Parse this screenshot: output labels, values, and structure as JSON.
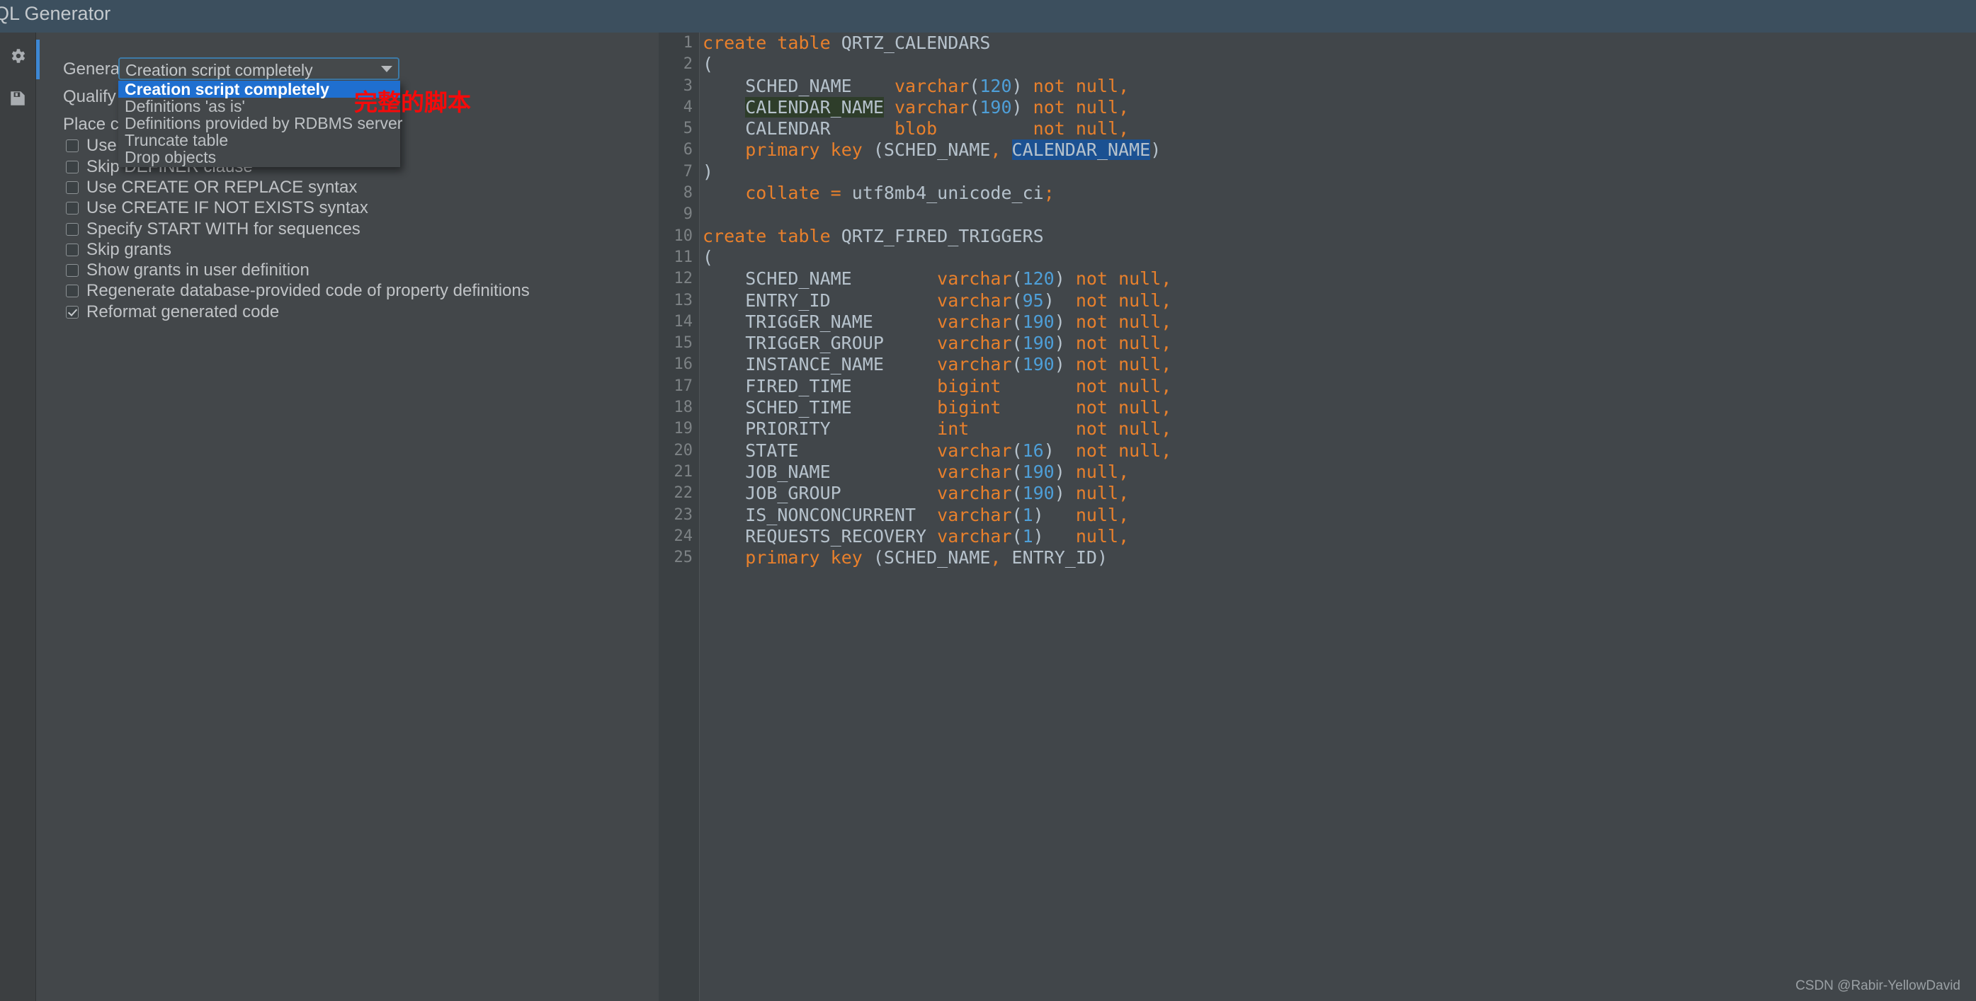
{
  "window": {
    "title": "QL Generator"
  },
  "toolstrip": {
    "items": [
      {
        "name": "settings-icon",
        "label": "gear-icon"
      },
      {
        "name": "save-icon",
        "label": "floppy-disk-icon"
      }
    ]
  },
  "options_panel": {
    "generate_label": "Generate:",
    "qualify_label": "Qualify ob",
    "place_label": "Place cons",
    "combo": {
      "value": "Creation script completely",
      "options": [
        "Creation script completely",
        "Definitions 'as is'",
        "Definitions provided by RDBMS server",
        "Truncate table",
        "Drop objects"
      ],
      "selected_index": 0
    },
    "checkboxes": [
      {
        "label": "Use su",
        "checked": false
      },
      {
        "label": "Skip DEFINER clause",
        "checked": false
      },
      {
        "label": "Use CREATE OR REPLACE syntax",
        "checked": false
      },
      {
        "label": "Use CREATE IF NOT EXISTS syntax",
        "checked": false
      },
      {
        "label": "Specify START WITH for sequences",
        "checked": false
      },
      {
        "label": "Skip grants",
        "checked": false
      },
      {
        "label": "Show grants in user definition",
        "checked": false
      },
      {
        "label": "Regenerate database-provided code of property definitions",
        "checked": false
      },
      {
        "label": "Reformat generated code",
        "checked": true
      }
    ]
  },
  "annotation": {
    "text": "完整的脚本",
    "color": "#f60a0a"
  },
  "watermark": {
    "text": "CSDN @Rabir-YellowDavid"
  },
  "editor": {
    "language": "sql",
    "lines": [
      {
        "n": "1",
        "text": "create table QRTZ_CALENDARS"
      },
      {
        "n": "2",
        "text": "("
      },
      {
        "n": "3",
        "text": "    SCHED_NAME    varchar(120) not null,"
      },
      {
        "n": "4",
        "text": "    CALENDAR_NAME varchar(190) not null,"
      },
      {
        "n": "5",
        "text": "    CALENDAR      blob         not null,"
      },
      {
        "n": "6",
        "text": "    primary key (SCHED_NAME, CALENDAR_NAME)"
      },
      {
        "n": "7",
        "text": ")"
      },
      {
        "n": "8",
        "text": "    collate = utf8mb4_unicode_ci;"
      },
      {
        "n": "9",
        "text": ""
      },
      {
        "n": "10",
        "text": "create table QRTZ_FIRED_TRIGGERS"
      },
      {
        "n": "11",
        "text": "("
      },
      {
        "n": "12",
        "text": "    SCHED_NAME        varchar(120) not null,"
      },
      {
        "n": "13",
        "text": "    ENTRY_ID          varchar(95)  not null,"
      },
      {
        "n": "14",
        "text": "    TRIGGER_NAME      varchar(190) not null,"
      },
      {
        "n": "15",
        "text": "    TRIGGER_GROUP     varchar(190) not null,"
      },
      {
        "n": "16",
        "text": "    INSTANCE_NAME     varchar(190) not null,"
      },
      {
        "n": "17",
        "text": "    FIRED_TIME        bigint       not null,"
      },
      {
        "n": "18",
        "text": "    SCHED_TIME        bigint       not null,"
      },
      {
        "n": "19",
        "text": "    PRIORITY          int          not null,"
      },
      {
        "n": "20",
        "text": "    STATE             varchar(16)  not null,"
      },
      {
        "n": "21",
        "text": "    JOB_NAME          varchar(190) null,"
      },
      {
        "n": "22",
        "text": "    JOB_GROUP         varchar(190) null,"
      },
      {
        "n": "23",
        "text": "    IS_NONCONCURRENT  varchar(1)   null,"
      },
      {
        "n": "24",
        "text": "    REQUESTS_RECOVERY varchar(1)   null,"
      },
      {
        "n": "25",
        "text": "    primary key (SCHED_NAME, ENTRY_ID)"
      }
    ],
    "highlights": {
      "green_occurrence": "CALENDAR_NAME (line 4 column name)",
      "blue_selection": "CALENDAR_NAME (line 6 inside primary key)"
    }
  }
}
